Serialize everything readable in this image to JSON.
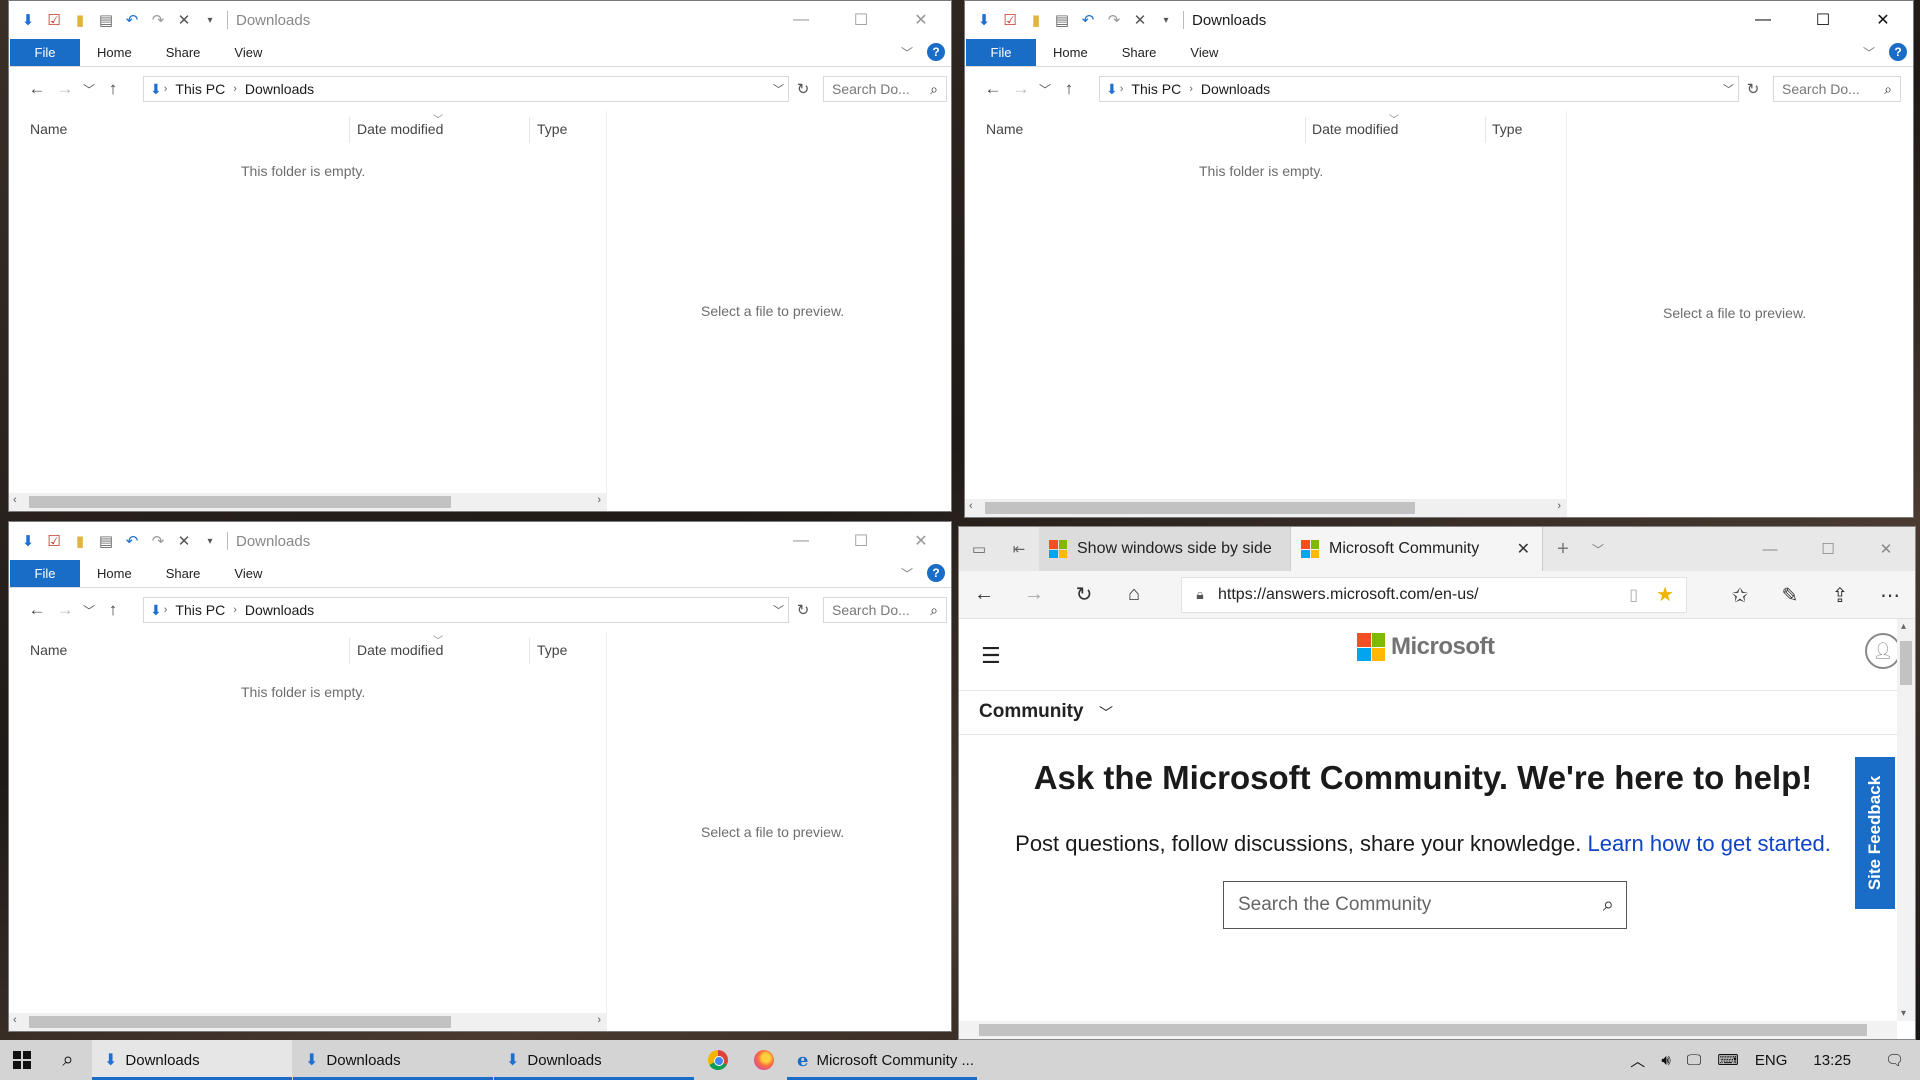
{
  "explorer": {
    "title": "Downloads",
    "tabs": [
      "File",
      "Home",
      "Share",
      "View"
    ],
    "breadcrumb": [
      "This PC",
      "Downloads"
    ],
    "search_placeholder": "Search Do...",
    "columns": [
      "Name",
      "Date modified",
      "Type"
    ],
    "empty_text": "This folder is empty.",
    "preview_text": "Select a file to preview."
  },
  "edge": {
    "tabs": [
      {
        "label": "Show windows side by side",
        "active": false
      },
      {
        "label": "Microsoft Community",
        "active": true
      }
    ],
    "url": "https://answers.microsoft.com/en-us/",
    "logo_text": "Microsoft",
    "nav_label": "Community",
    "hero_title": "Ask the Microsoft Community. We're here to help!",
    "hero_sub": "Post questions, follow discussions, share your knowledge.",
    "hero_link": "Learn how to get started.",
    "search_placeholder": "Search the Community",
    "feedback_label": "Site Feedback"
  },
  "taskbar": {
    "apps": [
      "Downloads",
      "Downloads",
      "Downloads"
    ],
    "edge_label": "Microsoft Community ...",
    "language": "ENG",
    "time": "13:25"
  },
  "icons": {
    "downloads": "down-arrow-icon",
    "back": "back-arrow-icon",
    "forward": "forward-arrow-icon",
    "up": "up-arrow-icon",
    "refresh": "refresh-icon",
    "search": "magnifier-icon",
    "close": "close-icon",
    "minimize": "minimize-icon",
    "maximize": "maximize-icon",
    "help": "help-icon",
    "favorite": "star-icon"
  },
  "colors": {
    "accent": "#1a6dc7",
    "link": "#0f44c7",
    "favorite_star": "#f0b400"
  }
}
